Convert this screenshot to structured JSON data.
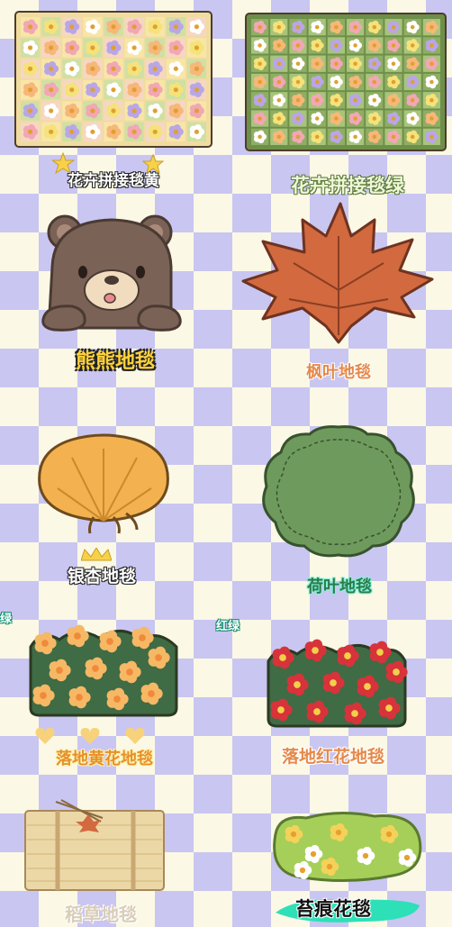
{
  "items": [
    {
      "id": "flower-patch-yellow",
      "label": "花卉拼接毯黄"
    },
    {
      "id": "flower-patch-green",
      "label": "花卉拼接毯绿"
    },
    {
      "id": "bear",
      "label": "熊熊地毯"
    },
    {
      "id": "maple",
      "label": "枫叶地毯"
    },
    {
      "id": "ginkgo",
      "label": "银杏地毯"
    },
    {
      "id": "lotus",
      "label": "荷叶地毯"
    },
    {
      "id": "yellow-flower",
      "label": "落地黄花地毯"
    },
    {
      "id": "red-flower",
      "label": "落地红花地毯"
    },
    {
      "id": "straw",
      "label": "稻草地毯"
    },
    {
      "id": "moss",
      "label": "苔痕花毯"
    }
  ],
  "side_tags": {
    "left": "绿",
    "right": "红绿"
  },
  "colors": {
    "checker_purple": "#c9c6f2",
    "checker_cream": "#fbf8e6",
    "label_yellow": "#ffd23a",
    "label_orange": "#e5894a"
  }
}
